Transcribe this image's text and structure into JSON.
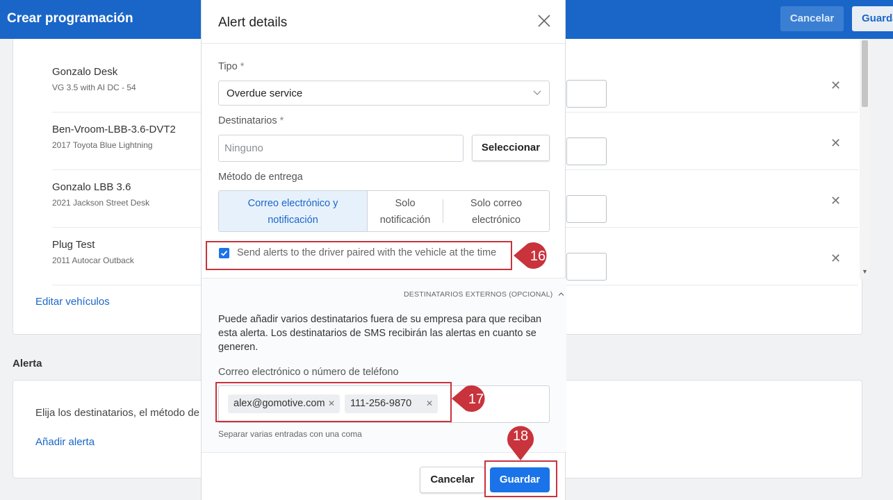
{
  "header": {
    "title": "Crear programación",
    "cancel_label": "Cancelar",
    "save_label": "Guardar"
  },
  "vehicles": {
    "items": [
      {
        "name": "Gonzalo Desk",
        "detail": "VG 3.5 with AI DC - 54"
      },
      {
        "name": "Ben-Vroom-LBB-3.6-DVT2",
        "detail": "2017 Toyota Blue Lightning"
      },
      {
        "name": "Gonzalo LBB 3.6",
        "detail": "2021 Jackson Street Desk"
      },
      {
        "name": "Plug Test",
        "detail": "2011 Autocar Outback"
      }
    ],
    "edit_link": "Editar vehículos"
  },
  "alert_section": {
    "heading": "Alerta",
    "description": "Elija los destinatarios, el método de",
    "add_link": "Añadir alerta"
  },
  "modal": {
    "title": "Alert details",
    "type_label": "Tipo",
    "type_value": "Overdue service",
    "recipients_label": "Destinatarios",
    "recipients_placeholder": "Ninguno",
    "select_button": "Seleccionar",
    "delivery_label": "Método de entrega",
    "delivery_options": [
      {
        "line1": "Correo electrónico y",
        "line2": "notificación",
        "active": true
      },
      {
        "line1": "Solo",
        "line2": "notificación",
        "active": false
      },
      {
        "line1": "Solo correo",
        "line2": "electrónico",
        "active": false
      }
    ],
    "driver_checkbox_label": "Send alerts to the driver paired with the vehicle at the time",
    "driver_checkbox_checked": true,
    "external_toggle": "DESTINATARIOS EXTERNOS (OPCIONAL)",
    "external_description": "Puede añadir varios destinatarios fuera de su empresa para que reciban esta alerta. Los destinatarios de SMS recibirán las alertas en cuanto se generen.",
    "contact_label": "Correo electrónico o número de teléfono",
    "contact_tags": [
      "alex@gomotive.com",
      "111-256-9870"
    ],
    "contact_help": "Separar varias entradas con una coma",
    "cancel_button": "Cancelar",
    "save_button": "Guardar"
  },
  "annotations": {
    "step_16": "16",
    "step_17": "17",
    "step_18": "18",
    "color": "#c8333c"
  },
  "colors": {
    "header_blue": "#1a66c8",
    "primary_button": "#1a73e8",
    "active_segment": "#e7f1fc"
  }
}
